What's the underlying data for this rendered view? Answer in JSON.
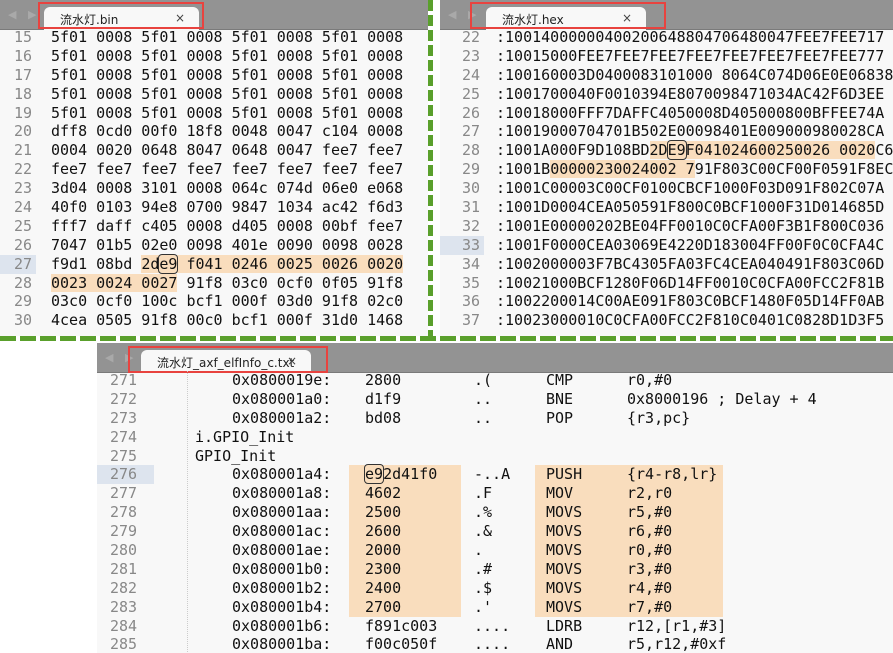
{
  "bin_panel": {
    "tab": "流水灯.bin",
    "close": "×",
    "nav": "◀ ▶",
    "current_line": "27",
    "lines": [
      {
        "n": "15",
        "seg": [
          {
            "t": "5f01 0008 5f01 0008 5f01 0008 5f01 0008"
          }
        ]
      },
      {
        "n": "16",
        "seg": [
          {
            "t": "5f01 0008 5f01 0008 5f01 0008 5f01 0008"
          }
        ]
      },
      {
        "n": "17",
        "seg": [
          {
            "t": "5f01 0008 5f01 0008 5f01 0008 5f01 0008"
          }
        ]
      },
      {
        "n": "18",
        "seg": [
          {
            "t": "5f01 0008 5f01 0008 5f01 0008 5f01 0008"
          }
        ]
      },
      {
        "n": "19",
        "seg": [
          {
            "t": "5f01 0008 5f01 0008 5f01 0008 5f01 0008"
          }
        ]
      },
      {
        "n": "20",
        "seg": [
          {
            "t": "dff8 0cd0 00f0 18f8 0048 0047 c104 0008"
          }
        ]
      },
      {
        "n": "21",
        "seg": [
          {
            "t": "0004 0020 0648 8047 0648 0047 fee7 fee7"
          }
        ]
      },
      {
        "n": "22",
        "seg": [
          {
            "t": "fee7 fee7 fee7 fee7 fee7 fee7 fee7 fee7"
          }
        ]
      },
      {
        "n": "23",
        "seg": [
          {
            "t": "3d04 0008 3101 0008 064c 074d 06e0 e068"
          }
        ]
      },
      {
        "n": "24",
        "seg": [
          {
            "t": "40f0 0103 94e8 0700 9847 1034 ac42 f6d3"
          }
        ]
      },
      {
        "n": "25",
        "seg": [
          {
            "t": "fff7 daff c405 0008 d405 0008 00bf fee7"
          }
        ]
      },
      {
        "n": "26",
        "seg": [
          {
            "t": "7047 01b5 02e0 0098 401e 0090 0098 0028"
          }
        ]
      },
      {
        "n": "27",
        "seg": [
          {
            "t": "f9d1 08bd "
          },
          {
            "t": "2d",
            "hl": true
          },
          {
            "t": "e9",
            "hl": true,
            "box": true
          },
          {
            "t": " f041 0246 0025 0026 0020",
            "hl": true
          }
        ]
      },
      {
        "n": "28",
        "seg": [
          {
            "t": "0023 0024 0027",
            "hl": true
          },
          {
            "t": " 91f8 03c0 0cf0 0f05 91f8"
          }
        ]
      },
      {
        "n": "29",
        "seg": [
          {
            "t": "03c0 0cf0 100c bcf1 000f 03d0 91f8 02c0"
          }
        ]
      },
      {
        "n": "30",
        "seg": [
          {
            "t": "4cea 0505 91f8 00c0 bcf1 000f 31d0 1468"
          }
        ]
      }
    ]
  },
  "hex_panel": {
    "tab": "流水灯.hex",
    "close": "×",
    "nav": "◀ ▶",
    "current_line": "33",
    "lines": [
      {
        "n": "22",
        "seg": [
          {
            "t": ":10014000000400200648804706480047FEE7FEE717"
          }
        ]
      },
      {
        "n": "23",
        "seg": [
          {
            "t": ":10015000FEE7FEE7FEE7FEE7FEE7FEE7FEE7FEE777"
          }
        ]
      },
      {
        "n": "24",
        "seg": [
          {
            "t": ":100160003D0400083101000 8064C074D06E0E06838"
          }
        ]
      },
      {
        "n": "25",
        "seg": [
          {
            "t": ":1001700040F0010394E8070098471034AC42F6D3EE"
          }
        ]
      },
      {
        "n": "26",
        "seg": [
          {
            "t": ":10018000FFF7DAFFC4050008D405000800BFFEE74A"
          }
        ]
      },
      {
        "n": "27",
        "seg": [
          {
            "t": ":10019000704701B502E00098401E009000980028CA"
          }
        ]
      },
      {
        "n": "28",
        "seg": [
          {
            "t": ":1001A000F9D108BD"
          },
          {
            "t": "2D",
            "hl": true
          },
          {
            "t": "E9",
            "hl": true,
            "box": true
          },
          {
            "t": "F041024600250026 0020",
            "hl": true
          },
          {
            "t": "C6"
          }
        ]
      },
      {
        "n": "29",
        "seg": [
          {
            "t": ":1001B"
          },
          {
            "t": "00000230024002 7",
            "hl": true
          },
          {
            "t": "91F803C00CF00F0591F8EC"
          }
        ]
      },
      {
        "n": "30",
        "seg": [
          {
            "t": ":1001C00003C00CF0100CBCF1000F03D091F802C07A"
          }
        ]
      },
      {
        "n": "31",
        "seg": [
          {
            "t": ":1001D0004CEA050591F800C0BCF1000F31D014685D"
          }
        ]
      },
      {
        "n": "32",
        "seg": [
          {
            "t": ":1001E00000202BE04FF0010C0CFA00F3B1F800C036"
          }
        ]
      },
      {
        "n": "33",
        "seg": [
          {
            "t": ":1001F0000CEA03069E4220D183004FF00F0C0CFA4C"
          }
        ]
      },
      {
        "n": "34",
        "seg": [
          {
            "t": ":1002000003F7BC4305FA03FC4CEA040491F803C06D"
          }
        ]
      },
      {
        "n": "35",
        "seg": [
          {
            "t": ":10021000BCF1280F06D14FF0010C0CFA00FCC2F81B"
          }
        ]
      },
      {
        "n": "36",
        "seg": [
          {
            "t": ":1002200014C00AE091F803C0BCF1480F05D14FF0AB"
          }
        ]
      },
      {
        "n": "37",
        "seg": [
          {
            "t": ":10023000010C0CFA00FCC2F810C0401C0828D1D3F5"
          }
        ]
      }
    ]
  },
  "elf_panel": {
    "tab": "流水灯_axf_elfInfo_c.txt",
    "close": "×",
    "nav": "◀ ▶",
    "current_line": "276",
    "lines": [
      {
        "n": "271",
        "addr": "0x0800019e:",
        "hex": "2800",
        "ascii": ".(",
        "mn": "CMP",
        "op": "r0,#0"
      },
      {
        "n": "272",
        "addr": "0x080001a0:",
        "hex": "d1f9",
        "ascii": "..",
        "mn": "BNE",
        "op": "0x8000196 ; Delay + 4"
      },
      {
        "n": "273",
        "addr": "0x080001a2:",
        "hex": "bd08",
        "ascii": "..",
        "mn": "POP",
        "op": "{r3,pc}"
      },
      {
        "n": "274",
        "label": "i.GPIO_Init"
      },
      {
        "n": "275",
        "label": "GPIO_Init"
      },
      {
        "n": "276",
        "addr": "0x080001a4:",
        "hex": "e92d41f0",
        "ascii": "-..A",
        "mn": "PUSH",
        "op": "{r4-r8,lr}",
        "hl": true,
        "box": "e9"
      },
      {
        "n": "277",
        "addr": "0x080001a8:",
        "hex": "4602",
        "ascii": ".F",
        "mn": "MOV",
        "op": "r2,r0",
        "hl": true
      },
      {
        "n": "278",
        "addr": "0x080001aa:",
        "hex": "2500",
        "ascii": ".%",
        "mn": "MOVS",
        "op": "r5,#0",
        "hl": true
      },
      {
        "n": "279",
        "addr": "0x080001ac:",
        "hex": "2600",
        "ascii": ".&",
        "mn": "MOVS",
        "op": "r6,#0",
        "hl": true
      },
      {
        "n": "280",
        "addr": "0x080001ae:",
        "hex": "2000",
        "ascii": ".",
        "mn": "MOVS",
        "op": "r0,#0",
        "hl": true
      },
      {
        "n": "281",
        "addr": "0x080001b0:",
        "hex": "2300",
        "ascii": ".#",
        "mn": "MOVS",
        "op": "r3,#0",
        "hl": true
      },
      {
        "n": "282",
        "addr": "0x080001b2:",
        "hex": "2400",
        "ascii": ".$",
        "mn": "MOVS",
        "op": "r4,#0",
        "hl": true
      },
      {
        "n": "283",
        "addr": "0x080001b4:",
        "hex": "2700",
        "ascii": ".'",
        "mn": "MOVS",
        "op": "r7,#0",
        "hl": true
      },
      {
        "n": "284",
        "addr": "0x080001b6:",
        "hex": "f891c003",
        "ascii": "....",
        "mn": "LDRB",
        "op": "r12,[r1,#3]"
      },
      {
        "n": "285",
        "addr": "0x080001ba:",
        "hex": "f00c050f",
        "ascii": "....",
        "mn": "AND",
        "op": "r5,r12,#0xf"
      }
    ]
  },
  "colors": {
    "highlight": "#f9ddbd",
    "annotation_box": "#e8433f",
    "divider": "#5aa02c",
    "current_line": "#dde4ee"
  }
}
